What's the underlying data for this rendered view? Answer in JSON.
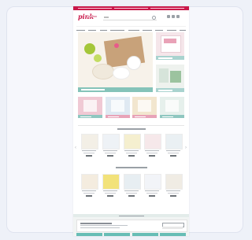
{
  "page": {
    "background": "#eef1f8",
    "card_border": "#dfe3ef"
  },
  "site": {
    "brand_color": "#c9184a",
    "accent_teal": "#4fb3a9",
    "logo_text": "pink",
    "header_icons": [
      "account-icon",
      "wishlist-icon",
      "cart-icon"
    ],
    "nav_item_count": 9,
    "hero": {
      "theme": "summer lime kitchenware",
      "caption_color": "#78beb4"
    },
    "sections": [
      {
        "name": "best-sellers",
        "product_count": 5
      },
      {
        "name": "new-arrivals",
        "product_count": 5
      }
    ],
    "tiles": [
      {
        "color": "#f0c9d4",
        "band": "#8fc7c0"
      },
      {
        "color": "#dfe9f2",
        "band": "#e8a3b8"
      },
      {
        "color": "#f2e6cf",
        "band": "#e8a3b8"
      },
      {
        "color": "#e6f0ec",
        "band": "#8fc7c0"
      }
    ],
    "products_row1": [
      {
        "img_color": "#f3efe6"
      },
      {
        "img_color": "#eef2f6"
      },
      {
        "img_color": "#f5efcf"
      },
      {
        "img_color": "#f6e8ea"
      },
      {
        "img_color": "#eaf0f3"
      }
    ],
    "products_row2": [
      {
        "img_color": "#f4ecdf"
      },
      {
        "img_color": "#f2e27a"
      },
      {
        "img_color": "#e7eef2"
      },
      {
        "img_color": "#f2f4f8"
      },
      {
        "img_color": "#f0ece4"
      }
    ]
  }
}
